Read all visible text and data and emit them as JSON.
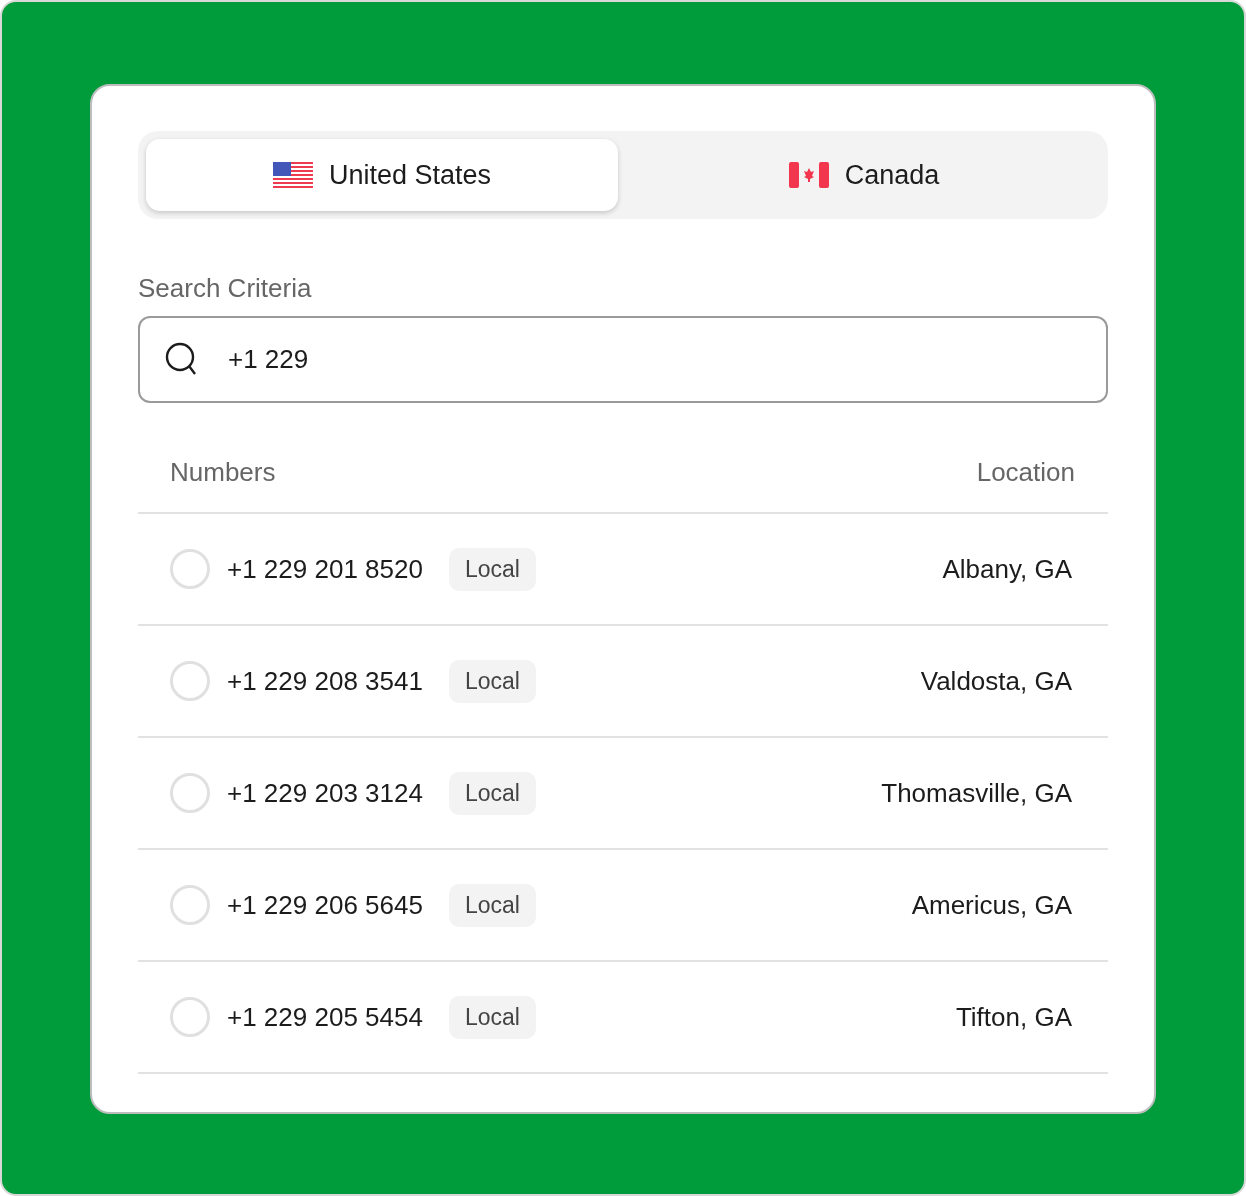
{
  "tabs": [
    {
      "label": "United States",
      "selected": true
    },
    {
      "label": "Canada",
      "selected": false
    }
  ],
  "search": {
    "label": "Search Criteria",
    "value": "+1 229"
  },
  "table": {
    "columns": [
      "Numbers",
      "Location"
    ],
    "rows": [
      {
        "number": "+1 229 201 8520",
        "tag": "Local",
        "location": "Albany, GA",
        "selected": false
      },
      {
        "number": "+1 229 208 3541",
        "tag": "Local",
        "location": "Valdosta, GA",
        "selected": false
      },
      {
        "number": "+1 229 203 3124",
        "tag": "Local",
        "location": "Thomasville, GA",
        "selected": false
      },
      {
        "number": "+1 229 206 5645",
        "tag": "Local",
        "location": "Americus, GA",
        "selected": false
      },
      {
        "number": "+1 229 205 5454",
        "tag": "Local",
        "location": "Tifton, GA",
        "selected": false
      }
    ]
  }
}
